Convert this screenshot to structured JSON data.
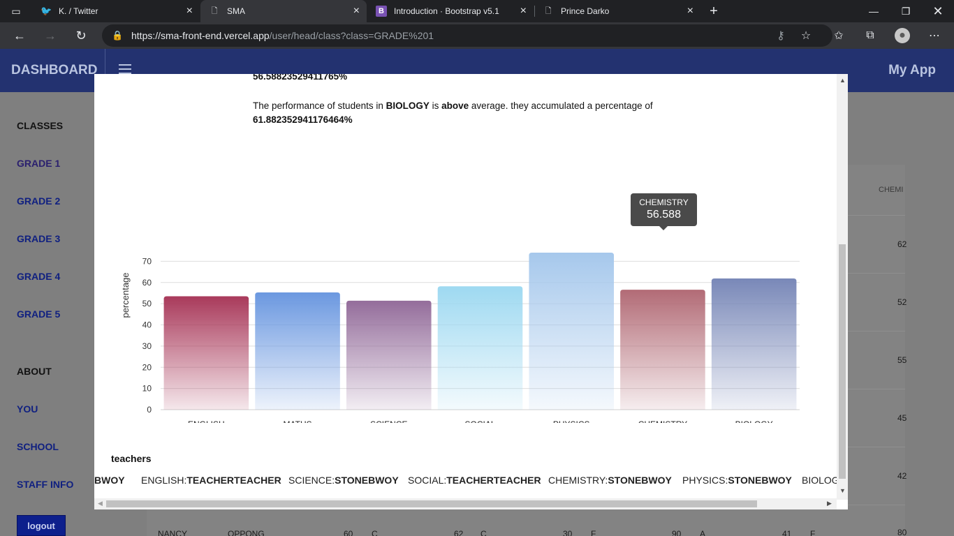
{
  "browser": {
    "tabs": [
      {
        "title": "K. / Twitter",
        "icon": "twitter-icon"
      },
      {
        "title": "SMA",
        "icon": "page-icon"
      },
      {
        "title": "Introduction · Bootstrap v5.1",
        "icon": "bootstrap-icon"
      },
      {
        "title": "Prince Darko",
        "icon": "page-icon"
      }
    ],
    "url_host": "https://sma-front-end.vercel.app",
    "url_path": "/user/head/class?class=GRADE%201"
  },
  "app": {
    "brand": "DASHBOARD",
    "name": "My App",
    "accent": "#233270"
  },
  "sidebar": {
    "classes_heading": "CLASSES",
    "classes": [
      "GRADE 1",
      "GRADE 2",
      "GRADE 3",
      "GRADE 4",
      "GRADE 5"
    ],
    "about_heading": "ABOUT",
    "about": [
      "YOU",
      "SCHOOL",
      "STAFF INFO"
    ],
    "logout": "logout"
  },
  "background_table": {
    "header_fragment": "CHEMI",
    "right_values": [
      "62",
      "52",
      "55",
      "45",
      "42",
      "80"
    ],
    "bottom_row": [
      "NANCY",
      "OPPONG",
      "60",
      "C",
      "62",
      "C",
      "30",
      "F",
      "90",
      "A",
      "41",
      "F"
    ]
  },
  "modal": {
    "text_top_value": "56.58823529411765%",
    "biology_sentence": {
      "pre": "The performance of students in ",
      "subject": "BIOLOGY",
      "mid": " is ",
      "status": "above",
      "post": " average. they accumulated a percentage of",
      "value": "61.882352941176464%"
    },
    "teachers_title": "teachers",
    "teachers": [
      {
        "subject": "",
        "name": "BWOY"
      },
      {
        "subject": "ENGLISH:",
        "name": "TEACHERTEACHER"
      },
      {
        "subject": "SCIENCE:",
        "name": "STONEBWOY"
      },
      {
        "subject": "SOCIAL:",
        "name": "TEACHERTEACHER"
      },
      {
        "subject": "CHEMISTRY:",
        "name": "STONEBWOY"
      },
      {
        "subject": "PHYSICS:",
        "name": "STONEBWOY"
      },
      {
        "subject": "BIOLOG",
        "name": ""
      }
    ],
    "tooltip": {
      "category": "CHEMISTRY",
      "value": "56.588"
    }
  },
  "chart_data": {
    "type": "bar",
    "categories": [
      "ENGLISH",
      "MATHS",
      "SCIENCE",
      "SOCIAL",
      "PHYSICS",
      "CHEMISTRY",
      "BIOLOGY"
    ],
    "values": [
      53.5,
      55.3,
      51.4,
      58.2,
      74.1,
      56.588,
      61.88
    ],
    "ylabel": "percentage",
    "xlabel": "",
    "ylim": [
      0,
      70
    ],
    "yticks": [
      0,
      10,
      20,
      30,
      40,
      50,
      60,
      70
    ],
    "grid": true,
    "colors": [
      "#a93a5b",
      "#6b98e0",
      "#946d9b",
      "#9ed9f1",
      "#a6c8ec",
      "#b26b76",
      "#7988b8"
    ]
  }
}
